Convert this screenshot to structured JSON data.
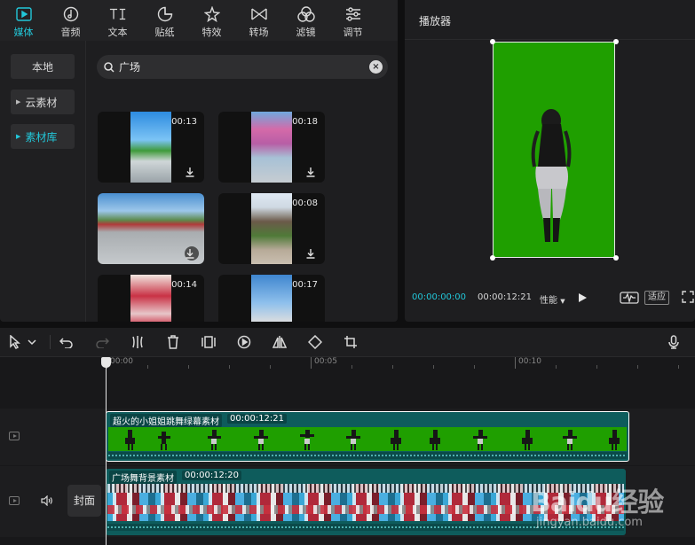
{
  "tabs": [
    {
      "label": "媒体",
      "icon": "media-icon",
      "active": true
    },
    {
      "label": "音频",
      "icon": "audio-icon"
    },
    {
      "label": "文本",
      "icon": "text-icon"
    },
    {
      "label": "贴纸",
      "icon": "sticker-icon"
    },
    {
      "label": "特效",
      "icon": "effects-icon"
    },
    {
      "label": "转场",
      "icon": "transition-icon"
    },
    {
      "label": "滤镜",
      "icon": "filter-icon"
    },
    {
      "label": "调节",
      "icon": "adjust-icon"
    }
  ],
  "side_nav": {
    "local": "本地",
    "cloud": "云素材",
    "library": "素材库"
  },
  "search": {
    "value": "广场"
  },
  "thumbnails": [
    {
      "duration": "00:13"
    },
    {
      "duration": "00:18"
    },
    {
      "duration": ""
    },
    {
      "duration": "00:08"
    },
    {
      "duration": "00:14"
    },
    {
      "duration": "00:17"
    }
  ],
  "player": {
    "title": "播放器",
    "time_current": "00:00:00:00",
    "time_total": "00:00:12:21",
    "performance": "性能",
    "fit_label": "适应"
  },
  "ruler": {
    "labels": [
      "00:00",
      "00:05",
      "00:10"
    ]
  },
  "tracks": {
    "clip1": {
      "name": "超火的小姐姐跳舞绿幕素材",
      "duration": "00:00:12:21"
    },
    "clip2": {
      "name": "广场舞背景素材",
      "duration": "00:00:12:20"
    },
    "cover_label": "封面"
  },
  "watermark": {
    "brand": "Baidu经验",
    "url": "jingyan.baidu.com"
  },
  "colors": {
    "accent": "#22c7d9",
    "green_screen": "#1f9f00",
    "clip_teal": "#0e5c5c"
  }
}
